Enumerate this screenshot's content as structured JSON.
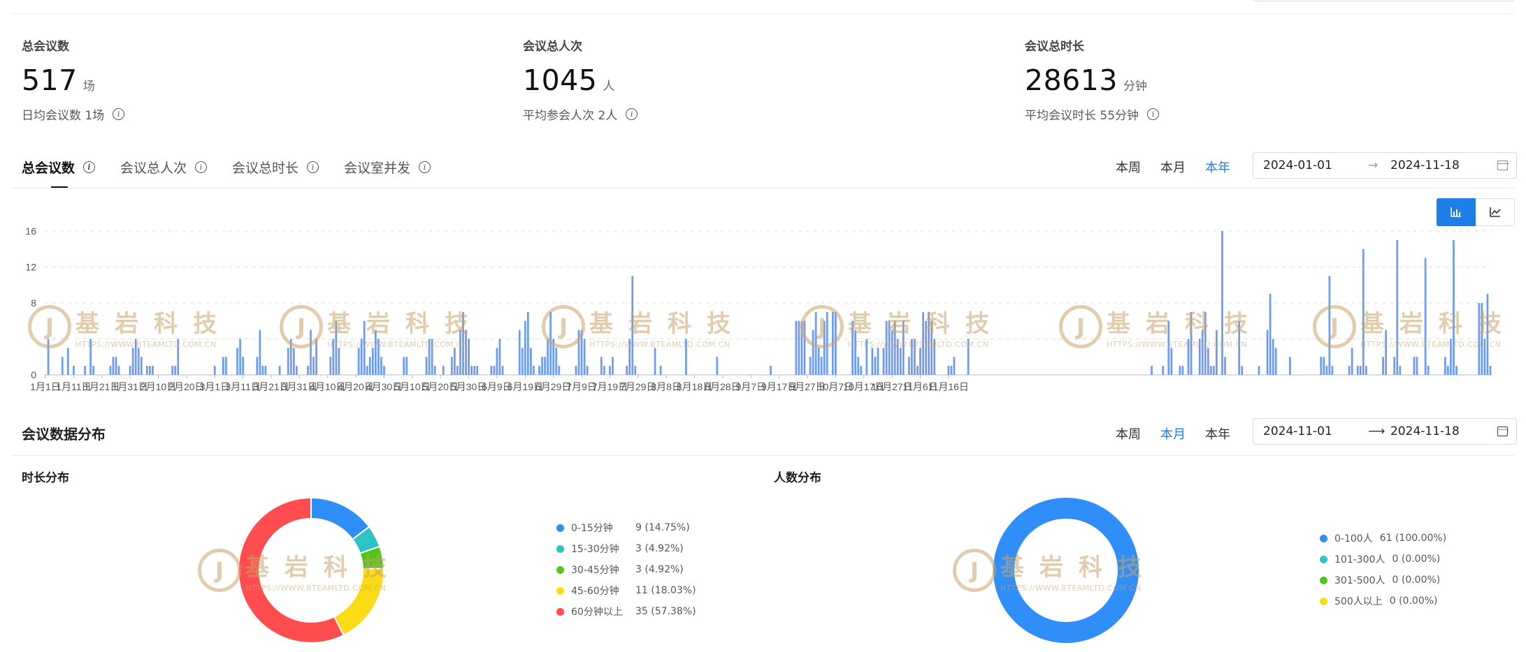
{
  "stats": [
    {
      "label": "总会议数",
      "value": "517",
      "unit": "场",
      "sub": "日均会议数 1场"
    },
    {
      "label": "会议总人次",
      "value": "1045",
      "unit": "人",
      "sub": "平均参会人次 2人"
    },
    {
      "label": "会议总时长",
      "value": "28613",
      "unit": "分钟",
      "sub": "平均会议时长 55分钟"
    }
  ],
  "tabs": [
    "总会议数",
    "会议总人次",
    "会议总时长",
    "会议室并发"
  ],
  "periods": [
    "本周",
    "本月",
    "本年"
  ],
  "top_range": {
    "start": "2024-01-01",
    "end": "2024-11-18",
    "arrow": "→"
  },
  "dist_section": {
    "title": "会议数据分布",
    "range": {
      "start": "2024-11-01",
      "end": "2024-11-18",
      "arrow": "⟶"
    },
    "duration_title": "时长分布",
    "people_title": "人数分布"
  },
  "watermark": {
    "logo": "J",
    "name": "基岩科技",
    "url": "HTTPS://WWW.BTEAMLTD.COM.CN"
  },
  "colors": {
    "accent": "#1e7ee8",
    "bar": "#6d9bf1",
    "watermark": "#c9a46a"
  },
  "chart_data": [
    {
      "type": "bar",
      "title": "",
      "xlabel": "",
      "ylabel": "",
      "ylim": [
        0,
        16
      ],
      "yticks": [
        0,
        4,
        8,
        12,
        16
      ],
      "ytick_labels": [
        "0",
        "",
        "8",
        "12",
        "16"
      ],
      "grid": true,
      "x_tick_labels": [
        "1月1日",
        "1月11日",
        "1月21日",
        "1月31日",
        "2月10日",
        "2月20日",
        "3月1日",
        "3月11日",
        "3月21日",
        "3月31日",
        "4月10日",
        "4月20日",
        "4月30日",
        "5月10日",
        "5月20日",
        "5月30日",
        "6月9日",
        "6月19日",
        "6月29日",
        "7月9日",
        "7月19日",
        "7月29日",
        "8月8日",
        "8月18日",
        "8月28日",
        "9月7日",
        "9月17日",
        "9月27日",
        "10月7日",
        "10月17日",
        "10月27日",
        "11月6日",
        "11月16日"
      ],
      "start_date": "2024-01-01",
      "values": [
        0,
        4,
        0,
        0,
        0,
        0,
        2,
        0,
        3,
        0,
        1,
        0,
        0,
        0,
        1,
        0,
        4,
        1,
        0,
        0,
        0,
        0,
        0,
        1,
        2,
        2,
        1,
        0,
        0,
        0,
        1,
        3,
        4,
        3,
        2,
        0,
        1,
        1,
        1,
        0,
        0,
        0,
        0,
        0,
        0,
        1,
        1,
        4,
        0,
        0,
        0,
        0,
        0,
        0,
        0,
        0,
        0,
        0,
        0,
        0,
        1,
        0,
        0,
        2,
        2,
        0,
        0,
        0,
        3,
        4,
        2,
        0,
        0,
        0,
        0,
        2,
        5,
        1,
        1,
        0,
        0,
        0,
        0,
        1,
        0,
        0,
        3,
        4,
        3,
        1,
        0,
        0,
        0,
        1,
        5,
        2,
        4,
        0,
        0,
        0,
        0,
        2,
        4,
        6,
        3,
        0,
        0,
        0,
        0,
        0,
        0,
        3,
        4,
        6,
        1,
        2,
        3,
        5,
        4,
        2,
        1,
        0,
        0,
        0,
        0,
        0,
        0,
        2,
        2,
        0,
        0,
        0,
        0,
        0,
        0,
        2,
        4,
        4,
        1,
        0,
        0,
        1,
        0,
        0,
        2,
        3,
        1,
        5,
        7,
        5,
        4,
        1,
        1,
        1,
        0,
        0,
        0,
        0,
        1,
        1,
        3,
        4,
        1,
        0,
        0,
        0,
        0,
        0,
        5,
        3,
        6,
        7,
        3,
        1,
        0,
        1,
        2,
        2,
        4,
        7,
        4,
        3,
        1,
        0,
        0,
        0,
        0,
        0,
        1,
        5,
        5,
        4,
        1,
        0,
        0,
        0,
        0,
        2,
        1,
        0,
        1,
        2,
        0,
        0,
        0,
        0,
        1,
        4,
        11,
        1,
        0,
        0,
        0,
        0,
        0,
        0,
        3,
        0,
        1,
        0,
        0,
        0,
        0,
        0,
        0,
        0,
        0,
        4,
        0,
        0,
        0,
        0,
        0,
        0,
        0,
        0,
        0,
        0,
        2,
        0,
        0,
        0,
        0,
        0,
        0,
        0,
        0,
        0,
        0,
        0,
        0,
        0,
        0,
        0,
        0,
        0,
        0,
        1,
        0,
        0,
        0,
        0,
        0,
        0,
        0,
        0,
        6,
        6,
        6,
        6,
        0,
        2,
        5,
        7,
        3,
        2,
        6,
        7,
        0,
        7,
        7,
        0,
        0,
        0,
        0,
        0,
        6,
        5,
        2,
        1,
        0,
        4,
        0,
        3,
        2,
        3,
        0,
        3,
        6,
        6,
        5,
        6,
        4,
        3,
        6,
        0,
        2,
        4,
        4,
        1,
        3,
        7,
        6,
        7,
        6,
        4,
        0,
        0,
        0,
        0,
        1,
        1,
        2,
        0,
        0,
        0,
        0,
        4,
        0,
        0,
        0,
        0,
        0,
        0,
        0,
        0,
        0,
        0,
        0,
        0,
        0,
        0,
        0,
        0,
        0,
        0,
        0,
        0,
        0,
        0,
        0,
        0,
        0,
        0,
        0,
        0,
        0,
        0,
        0,
        0,
        0,
        0,
        0,
        0,
        0,
        0,
        0,
        0,
        0,
        0,
        0,
        0,
        0,
        0,
        0,
        0,
        0,
        0,
        0,
        0,
        0,
        0,
        0,
        0,
        0,
        0,
        0,
        0,
        0,
        0,
        0,
        0,
        1,
        0,
        0,
        0,
        1,
        0,
        6,
        3,
        0,
        0,
        1,
        1,
        0,
        4,
        7,
        0,
        0,
        4,
        5,
        7,
        3,
        1,
        1,
        5,
        0,
        16,
        2,
        0,
        0,
        0,
        0,
        6,
        1,
        0,
        0,
        0,
        0,
        0,
        1,
        0,
        0,
        5,
        9,
        4,
        3,
        0,
        0,
        0,
        0,
        2,
        0,
        0,
        0,
        0,
        0,
        0,
        0,
        0,
        0,
        0,
        2,
        2,
        1,
        11,
        1,
        0,
        0,
        0,
        0,
        0,
        1,
        3,
        0,
        1,
        1,
        14,
        1,
        0,
        0,
        0,
        0,
        0,
        2,
        5,
        0,
        0,
        2,
        15,
        1,
        0,
        0,
        0,
        0,
        2,
        2,
        0,
        0,
        13,
        1,
        0,
        0,
        0,
        0,
        0,
        2,
        1,
        4,
        15,
        1,
        0,
        0,
        0,
        0,
        0,
        0,
        0,
        8,
        8,
        4,
        9,
        1
      ]
    },
    {
      "type": "pie",
      "title": "时长分布",
      "labels": [
        "0-15分钟",
        "15-30分钟",
        "30-45分钟",
        "45-60分钟",
        "60分钟以上"
      ],
      "values": [
        9,
        3,
        3,
        11,
        35
      ],
      "percent_labels": [
        "9 (14.75%)",
        "3 (4.92%)",
        "3 (4.92%)",
        "11 (18.03%)",
        "35 (57.38%)"
      ],
      "colors": [
        "#2f8ef7",
        "#2ec4c4",
        "#52c41a",
        "#fadb14",
        "#ff4d4f"
      ],
      "legend": "right"
    },
    {
      "type": "pie",
      "title": "人数分布",
      "labels": [
        "0-100人",
        "101-300人",
        "301-500人",
        "500人以上"
      ],
      "values": [
        61,
        0,
        0,
        0
      ],
      "percent_labels": [
        "61 (100.00%)",
        "0 (0.00%)",
        "0 (0.00%)",
        "0 (0.00%)"
      ],
      "colors": [
        "#2f8ef7",
        "#2ec4c4",
        "#52c41a",
        "#fadb14"
      ],
      "legend": "right"
    }
  ]
}
